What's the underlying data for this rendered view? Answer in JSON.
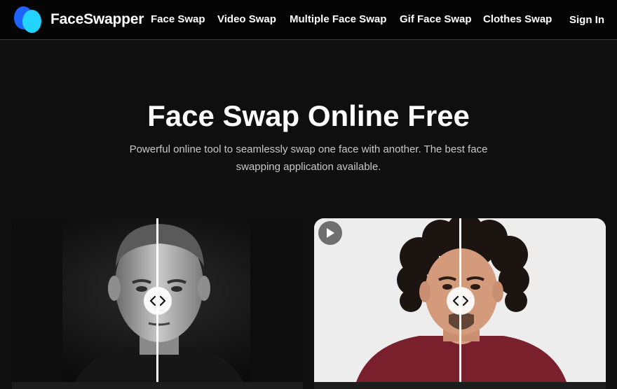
{
  "header": {
    "brand": "FaceSwapper",
    "nav": [
      "Face Swap",
      "Video Swap",
      "Multiple Face Swap",
      "Gif Face Swap",
      "Clothes Swap"
    ],
    "sign_in": "Sign In",
    "colors": {
      "logo_dark": "#1f63ff",
      "logo_light": "#22d3ff"
    }
  },
  "hero": {
    "title": "Face Swap Online Free",
    "subtitle_line1": "Powerful online tool to seamlessly swap one face with another. The best face",
    "subtitle_line2": "swapping application available."
  },
  "demos": [
    {
      "image": "black-and-white portrait of a man with buzz-cut hair",
      "slider": "compare-handle-icon"
    },
    {
      "image": "color photo of a man with curly hair in a maroon t-shirt",
      "slider": "compare-handle-icon",
      "overlay_icon": "play-icon"
    }
  ]
}
